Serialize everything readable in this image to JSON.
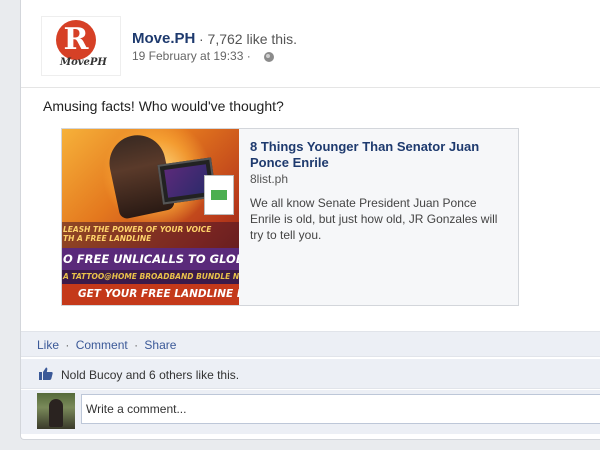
{
  "post": {
    "page_name": "Move.PH",
    "likes_line": "· 7,762 like this.",
    "timestamp": "19 February at 19:33 ·",
    "logo_text": "MovePH",
    "logo_letter": "R",
    "message": "Amusing facts! Who would've thought?"
  },
  "preview": {
    "title": "8 Things Younger Than Senator Juan Ponce Enrile",
    "domain": "8list.ph",
    "description": "We all know Senate President Juan Ponce Enrile is old, but just how old, JR Gonzales will try to tell you.",
    "banner_line1": "LEASH THE POWER OF YOUR VOICE",
    "banner_line1b": "TH A FREE LANDLINE",
    "banner_line2": "O FREE UNLICALLS TO GLOBE & T",
    "banner_line3": "A TATTOO@HOME BROADBAND BUNDLE N",
    "banner_line4": "GET YOUR FREE LANDLINE NOW"
  },
  "actions": {
    "like": "Like",
    "comment": "Comment",
    "share": "Share",
    "separator": "·"
  },
  "likes": {
    "text": "Nold Bucoy and 6 others like this."
  },
  "comment": {
    "placeholder": "Write a comment..."
  },
  "colors": {
    "link": "#3b5998",
    "name": "#1e3a6e",
    "bar_bg": "#eceff5",
    "page_bg": "#e9ebee"
  }
}
